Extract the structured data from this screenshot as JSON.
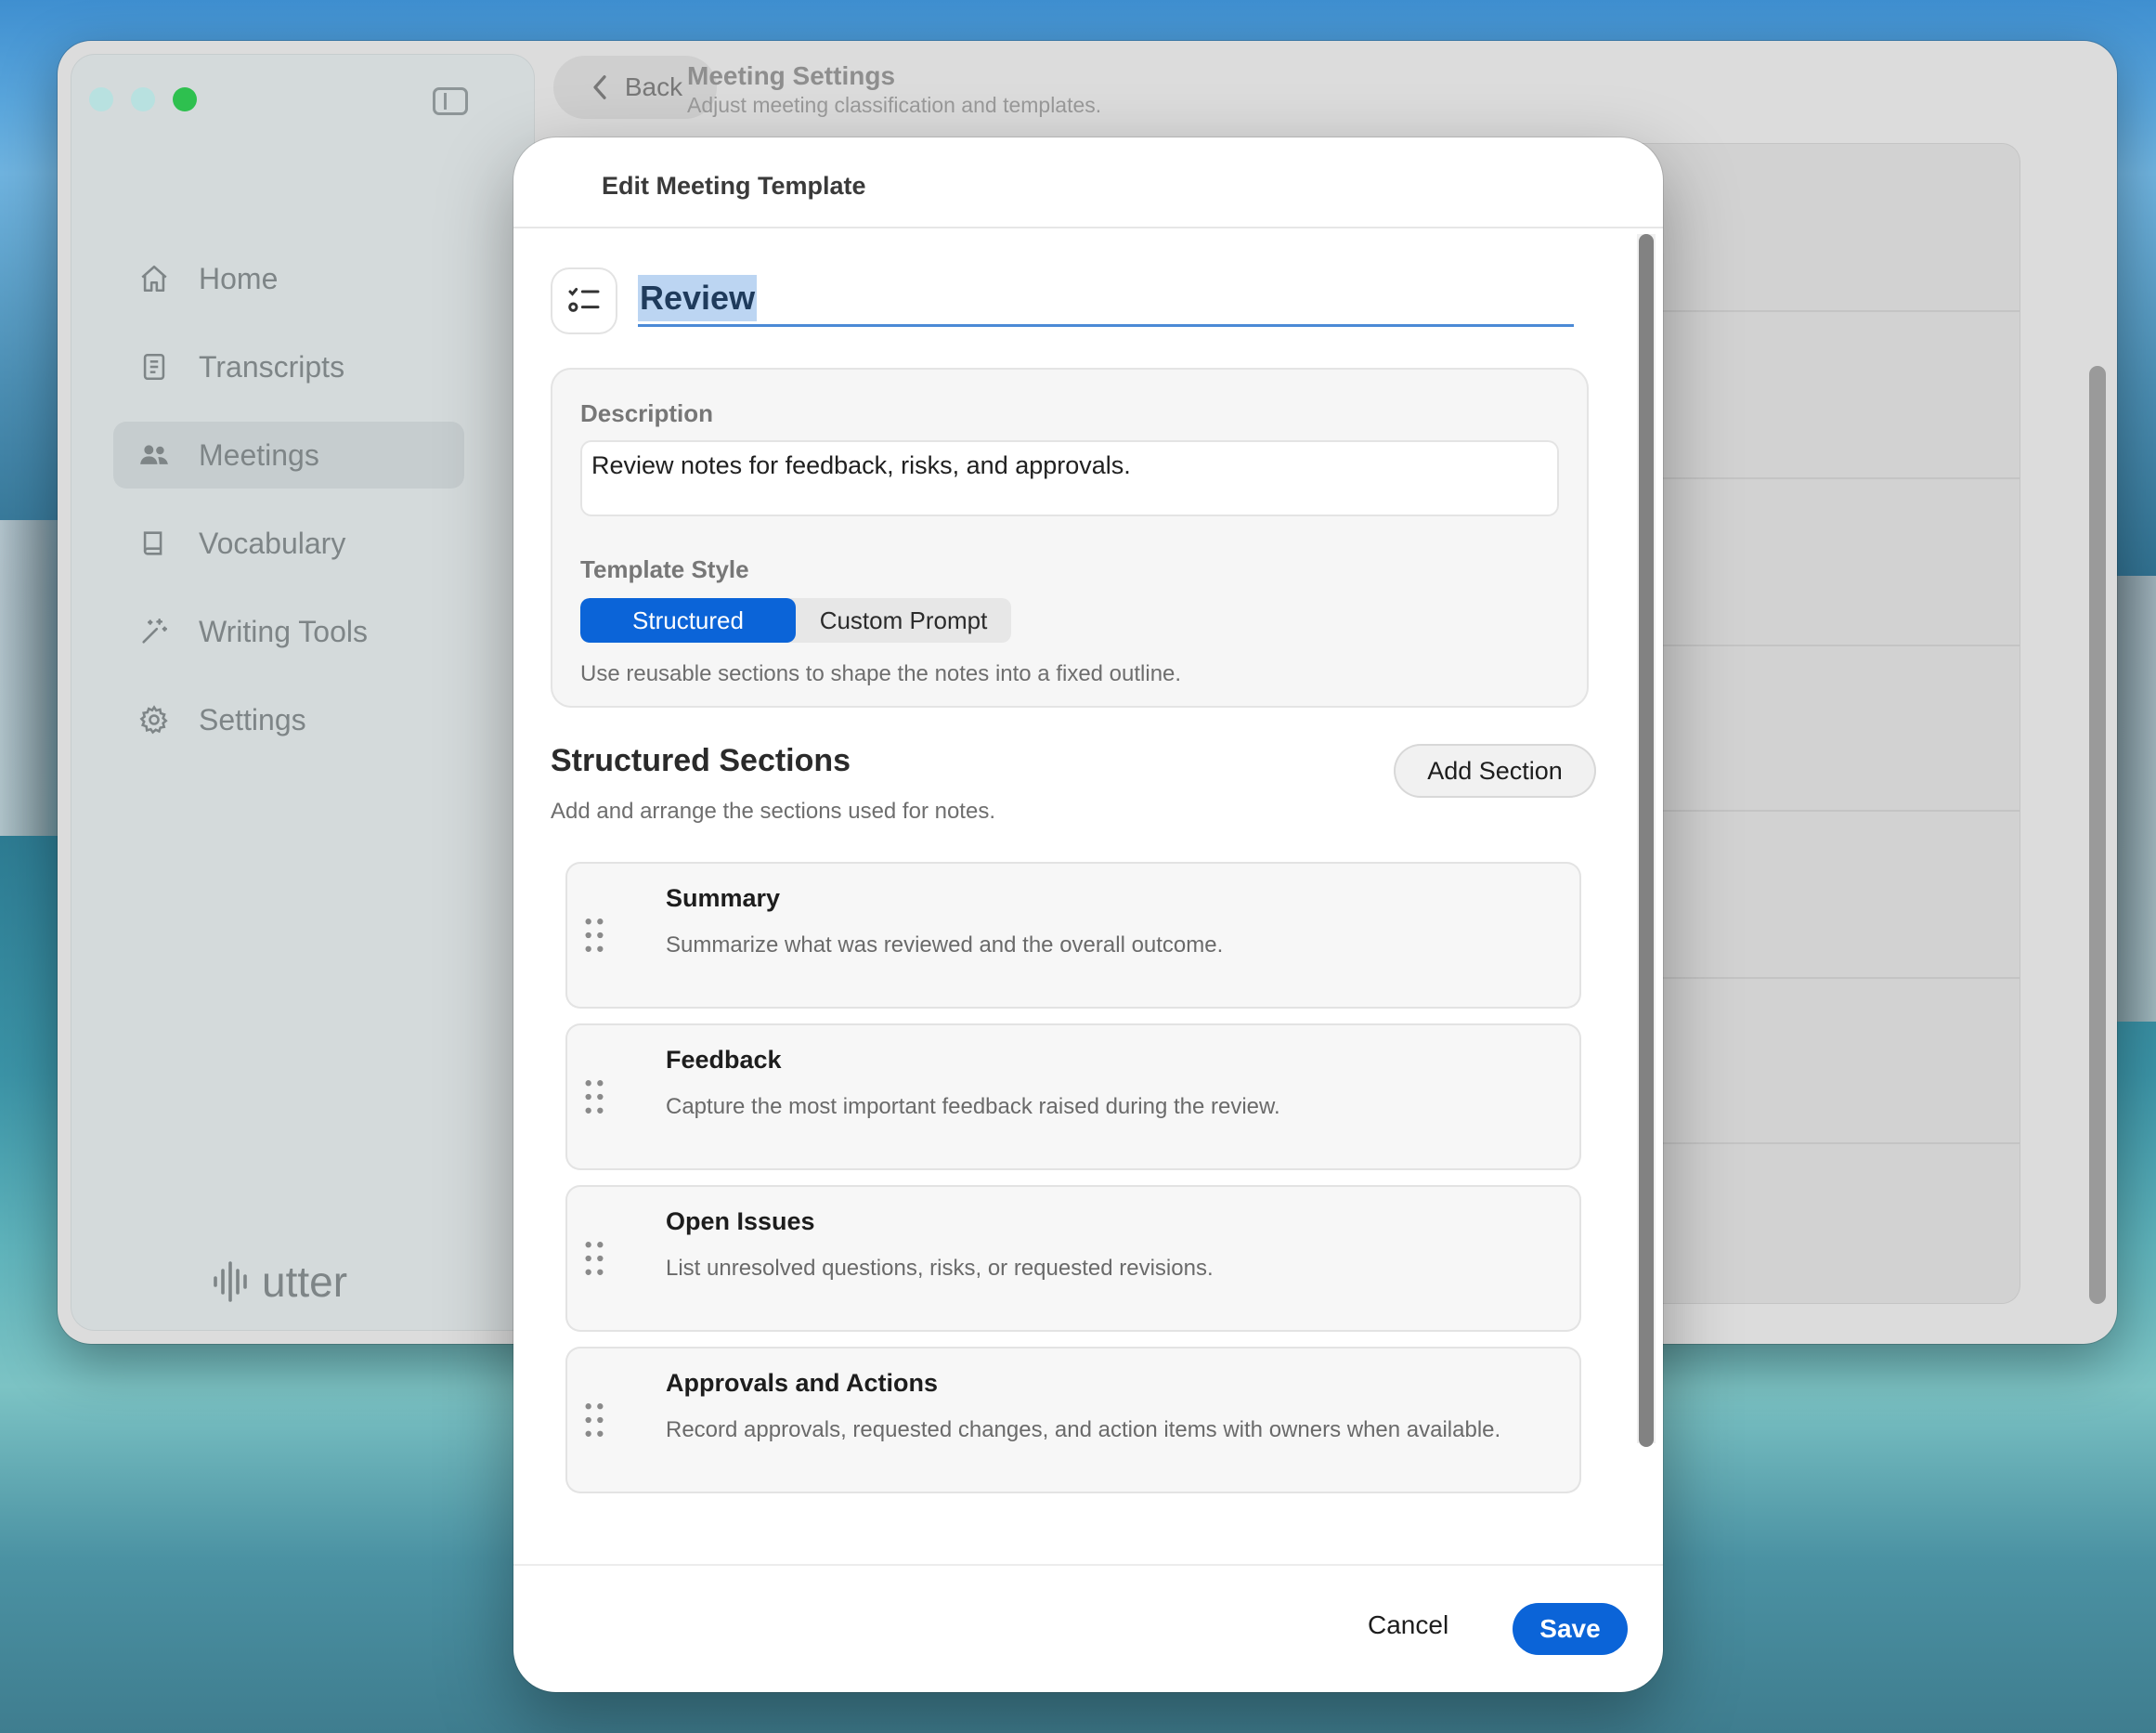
{
  "sidebar": {
    "items": [
      {
        "label": "Home",
        "icon": "home-icon",
        "active": false
      },
      {
        "label": "Transcripts",
        "icon": "document-icon",
        "active": false
      },
      {
        "label": "Meetings",
        "icon": "people-icon",
        "active": true
      },
      {
        "label": "Vocabulary",
        "icon": "book-icon",
        "active": false
      },
      {
        "label": "Writing Tools",
        "icon": "magic-wand-icon",
        "active": false
      },
      {
        "label": "Settings",
        "icon": "gear-icon",
        "active": false
      }
    ],
    "brand": "utter"
  },
  "header": {
    "back_label": "Back",
    "title": "Meeting Settings",
    "subtitle": "Adjust meeting classification and templates."
  },
  "modal": {
    "title": "Edit Meeting Template",
    "template_name": "Review",
    "description_label": "Description",
    "description_value": "Review notes for feedback, risks, and approvals.",
    "style_label": "Template Style",
    "style_options": [
      "Structured",
      "Custom Prompt"
    ],
    "style_selected": "Structured",
    "style_hint": "Use reusable sections to shape the notes into a fixed outline.",
    "sections_title": "Structured Sections",
    "sections_subtitle": "Add and arrange the sections used for notes.",
    "add_section_label": "Add Section",
    "sections": [
      {
        "name": "Summary",
        "description": "Summarize what was reviewed and the overall outcome."
      },
      {
        "name": "Feedback",
        "description": "Capture the most important feedback raised during the review."
      },
      {
        "name": "Open Issues",
        "description": "List unresolved questions, risks, or requested revisions."
      },
      {
        "name": "Approvals and Actions",
        "description": "Record approvals, requested changes, and action items with owners when available."
      }
    ],
    "cancel_label": "Cancel",
    "save_label": "Save"
  },
  "colors": {
    "accent": "#0b64d8",
    "selection": "#bcd5f2",
    "traffic_green": "#2ec04f"
  }
}
